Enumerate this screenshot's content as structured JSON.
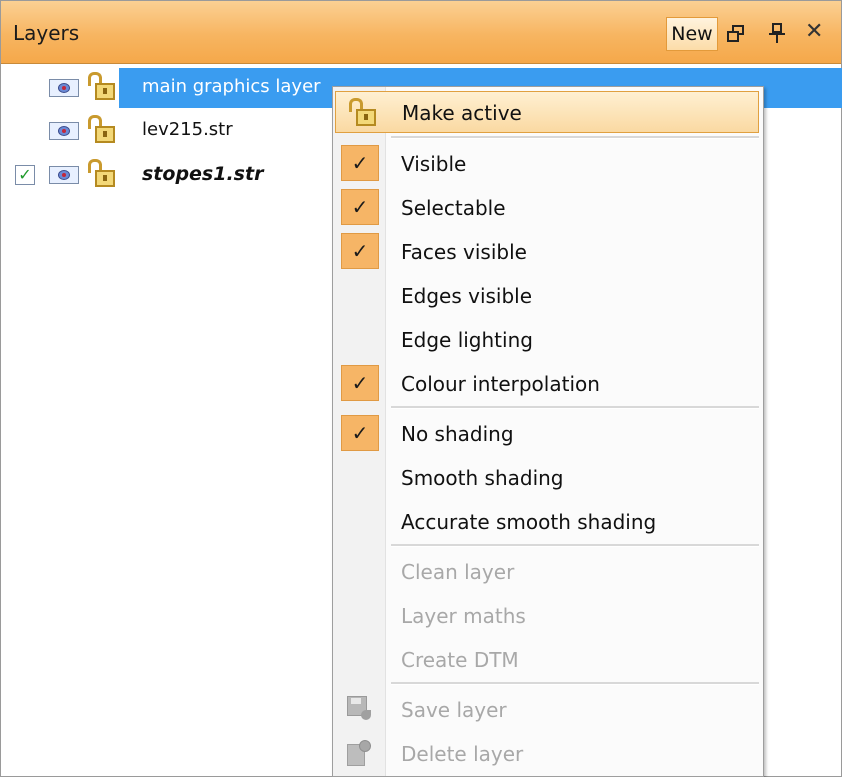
{
  "panel": {
    "title": "Layers",
    "new_label": "New",
    "close_glyph": "✕"
  },
  "layers": [
    {
      "name": "main graphics layer",
      "selected": true,
      "active": false,
      "icons": [
        "eye-icon",
        "unlocked-padlock-icon"
      ]
    },
    {
      "name": "lev215.str",
      "selected": false,
      "active": false,
      "icons": [
        "eye-icon",
        "unlocked-padlock-icon"
      ]
    },
    {
      "name": "stopes1.str",
      "selected": false,
      "active": true,
      "icons": [
        "checkbox-checked-icon",
        "eye-icon",
        "unlocked-padlock-icon"
      ]
    }
  ],
  "menu": {
    "items": [
      {
        "label": "Make active",
        "checked": false,
        "disabled": false,
        "icon": "unlocked-padlock-icon",
        "highlighted": true
      },
      {
        "label": "Visible",
        "checked": true,
        "disabled": false
      },
      {
        "label": "Selectable",
        "checked": true,
        "disabled": false
      },
      {
        "label": "Faces visible",
        "checked": true,
        "disabled": false
      },
      {
        "label": "Edges visible",
        "checked": false,
        "disabled": false
      },
      {
        "label": "Edge lighting",
        "checked": false,
        "disabled": false
      },
      {
        "label": "Colour interpolation",
        "checked": true,
        "disabled": false
      },
      {
        "label": "No shading",
        "checked": true,
        "disabled": false
      },
      {
        "label": "Smooth shading",
        "checked": false,
        "disabled": false
      },
      {
        "label": "Accurate smooth shading",
        "checked": false,
        "disabled": false
      },
      {
        "label": "Clean layer",
        "checked": false,
        "disabled": true
      },
      {
        "label": "Layer maths",
        "checked": false,
        "disabled": true
      },
      {
        "label": "Create DTM",
        "checked": false,
        "disabled": true
      },
      {
        "label": "Save layer",
        "checked": false,
        "disabled": true,
        "icon": "save-layer-icon"
      },
      {
        "label": "Delete layer",
        "checked": false,
        "disabled": true,
        "icon": "delete-layer-icon"
      }
    ],
    "check_glyph": "✓"
  },
  "colors": {
    "titlebar_orange": "#f7b561",
    "selection_blue": "#3a9cf0",
    "check_orange": "#f6b566",
    "disabled_text": "#a8a8a8"
  }
}
